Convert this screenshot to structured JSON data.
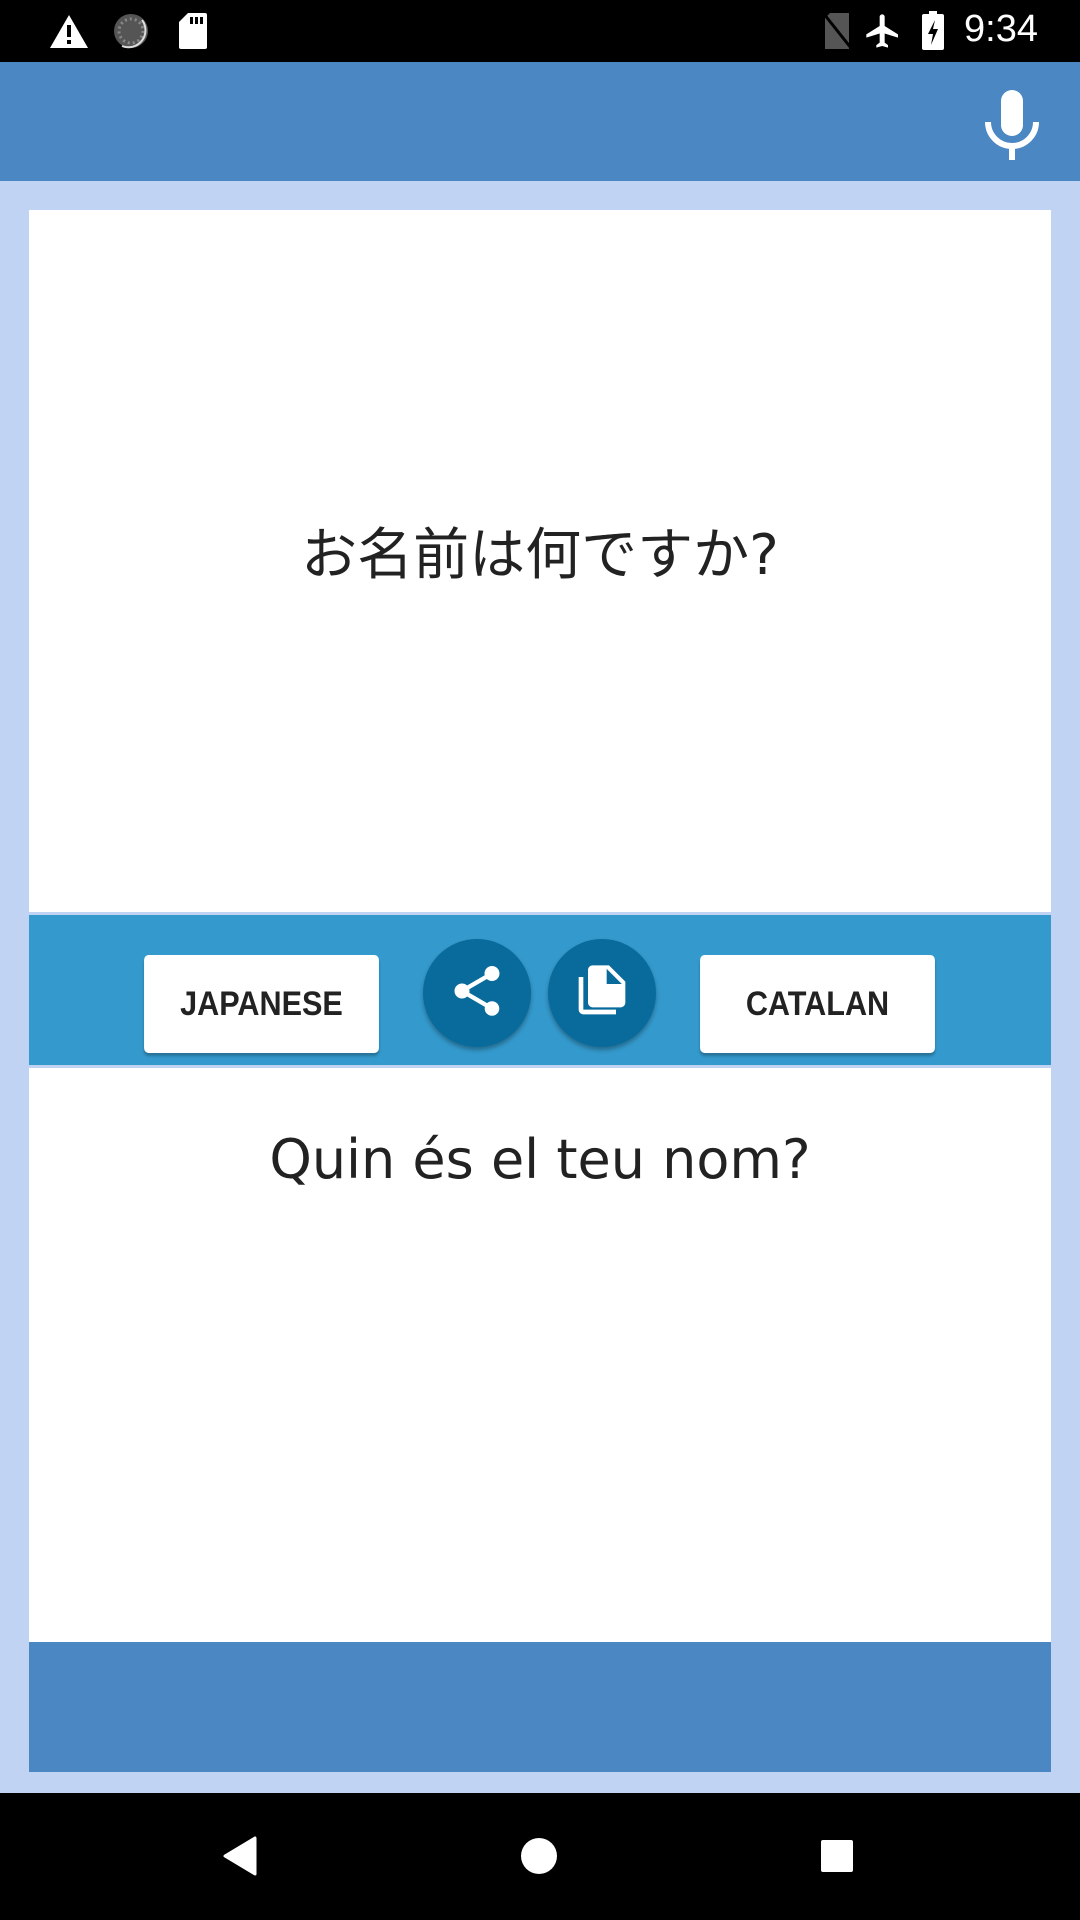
{
  "status_bar": {
    "time": "9:34",
    "left_icons": [
      "warning-icon",
      "sync-icon",
      "sd-card-icon"
    ],
    "right_icons": [
      "no-sim-icon",
      "airplane-mode-icon",
      "battery-charging-icon"
    ]
  },
  "app_bar": {
    "mic_icon": "microphone-icon"
  },
  "translator": {
    "source_text": "お名前は何ですか?",
    "target_text": "Quin és el teu nom?",
    "source_language": "JAPANESE",
    "target_language": "CATALAN",
    "share_icon": "share-icon",
    "copy_icon": "copy-icon"
  },
  "colors": {
    "app_bar": "#4a87c3",
    "background": "#c0d3f2",
    "toolbar": "#3499cc",
    "circle_button": "#086b9c"
  },
  "nav_bar": {
    "back": "back-icon",
    "home": "home-icon",
    "recents": "recents-icon"
  }
}
